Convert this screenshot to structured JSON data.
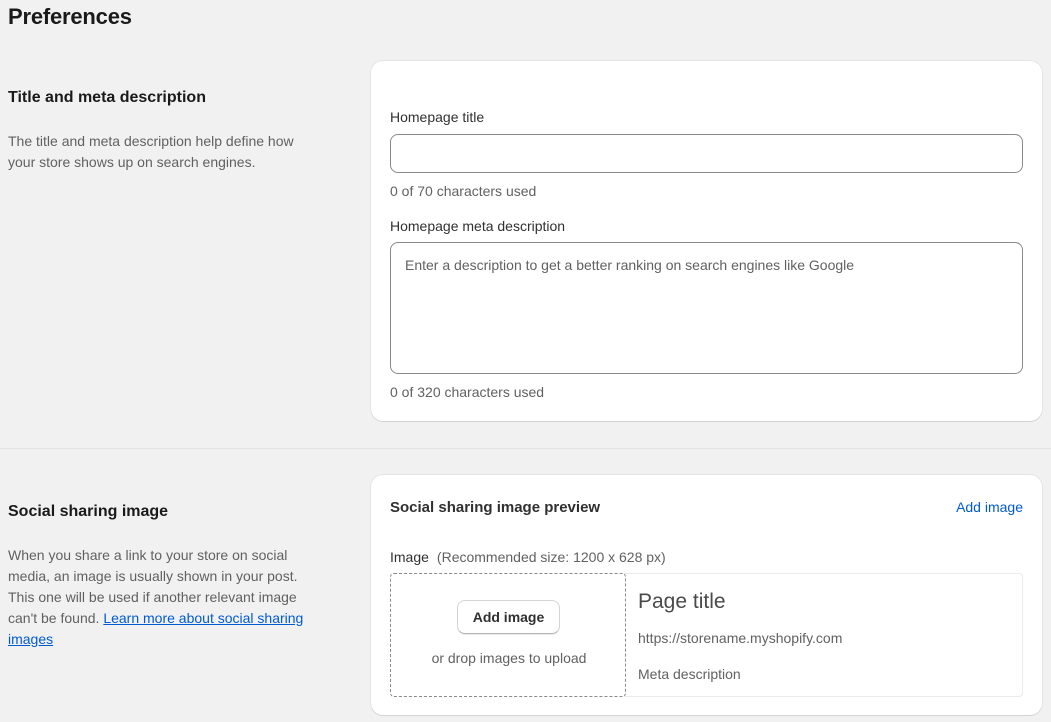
{
  "page": {
    "title": "Preferences"
  },
  "title_meta": {
    "heading": "Title and meta description",
    "description": "The title and meta description help define how your store shows up on search engines.",
    "homepage_title_label": "Homepage title",
    "homepage_title_value": "",
    "homepage_title_counter": "0 of 70 characters used",
    "meta_description_label": "Homepage meta description",
    "meta_description_placeholder": "Enter a description to get a better ranking on search engines like Google",
    "meta_description_counter": "0 of 320 characters used"
  },
  "social": {
    "heading": "Social sharing image",
    "description": "When you share a link to your store on social media, an image is usually shown in your post. This one will be used if another relevant image can't be found.",
    "learn_more_link": "Learn more about social sharing images",
    "card_heading": "Social sharing image preview",
    "add_image_link": "Add image",
    "image_label": "Image",
    "image_recommendation": "(Recommended size: 1200 x 628 px)",
    "add_image_button": "Add image",
    "drop_text": "or drop images to upload",
    "preview_title": "Page title",
    "preview_url": "https://storename.myshopify.com",
    "preview_meta": "Meta description"
  },
  "colors": {
    "background": "#f1f1f1",
    "card": "#ffffff",
    "link": "#005bd3",
    "text": "#303030",
    "muted": "#616161"
  }
}
